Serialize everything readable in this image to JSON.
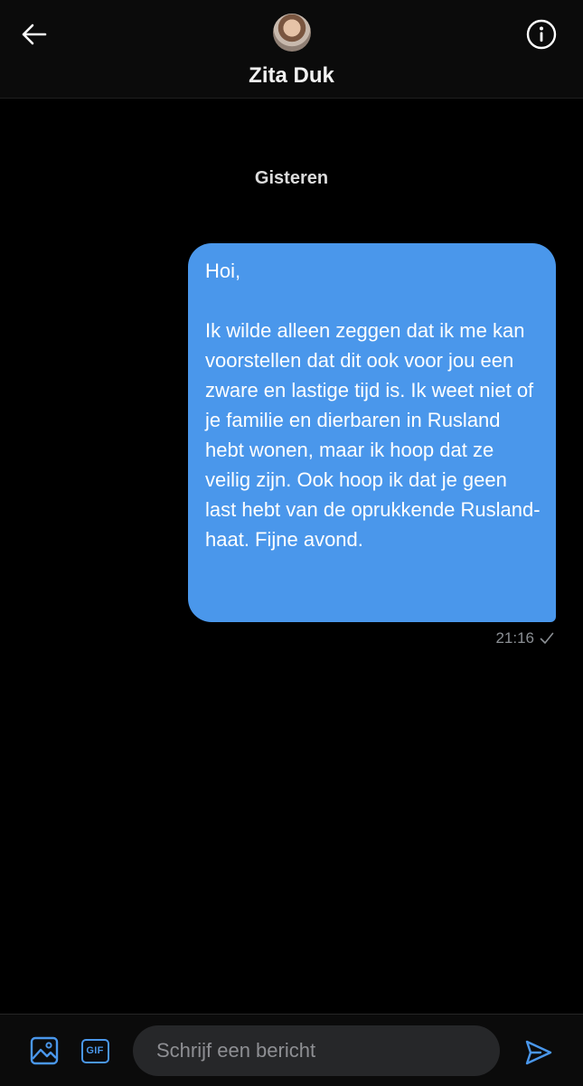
{
  "header": {
    "contact_name": "Zita Duk",
    "back_icon": "arrow-left-icon",
    "info_icon": "info-icon"
  },
  "conversation": {
    "date_separator": "Gisteren",
    "messages": [
      {
        "direction": "outgoing",
        "text": "Hoi,\n\nIk wilde alleen zeggen dat ik me kan voorstellen dat dit ook voor jou een zware en lastige tijd is. Ik weet niet of je familie en dierbaren in Rusland hebt wonen, maar ik hoop dat ze veilig zijn. Ook hoop ik dat je geen last hebt van de oprukkende Rusland-haat. Fijne avond.",
        "time": "21:16",
        "status_icon": "checkmark-icon"
      }
    ]
  },
  "composer": {
    "placeholder": "Schrijf een bericht",
    "gif_label": "GIF",
    "media_icon": "image-icon",
    "send_icon": "send-icon"
  },
  "colors": {
    "accent": "#4a97eb",
    "background": "#000000",
    "bubble": "#4a97eb",
    "meta_text": "#8b8f94"
  }
}
